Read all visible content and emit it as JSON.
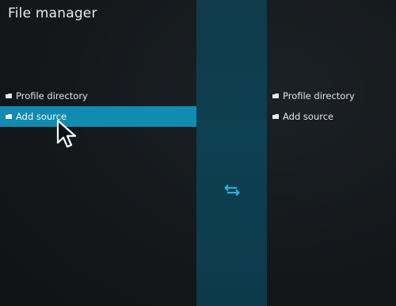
{
  "header": {
    "title": "File manager"
  },
  "left_pane": {
    "items": [
      {
        "label": "Profile directory",
        "icon": "folder-icon",
        "selected": false
      },
      {
        "label": "Add source",
        "icon": "folder-icon",
        "selected": true
      }
    ]
  },
  "right_pane": {
    "items": [
      {
        "label": "Profile directory",
        "icon": "folder-icon"
      },
      {
        "label": "Add source",
        "icon": "folder-icon"
      }
    ]
  },
  "center": {
    "icon": "swap-arrows-icon"
  },
  "colors": {
    "background": "#14181b",
    "selection": "#118bb0",
    "center_bar": "#0d4052",
    "accent_icon": "#1aa3d6"
  }
}
